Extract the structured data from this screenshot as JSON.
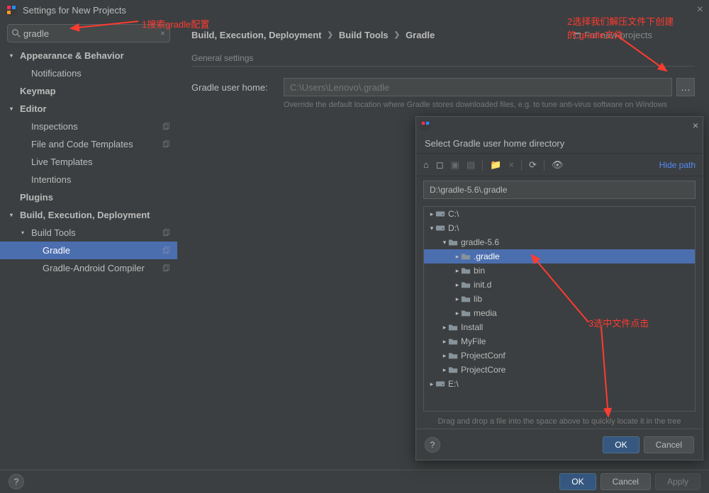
{
  "window": {
    "title": "Settings for New Projects"
  },
  "search": {
    "value": "gradle"
  },
  "sidebar": {
    "items": [
      {
        "label": "Appearance & Behavior",
        "bold": true,
        "arrow": "▾",
        "indent": 0
      },
      {
        "label": "Notifications",
        "bold": false,
        "arrow": "",
        "indent": 1
      },
      {
        "label": "Keymap",
        "bold": true,
        "arrow": "",
        "indent": 0
      },
      {
        "label": "Editor",
        "bold": true,
        "arrow": "▾",
        "indent": 0
      },
      {
        "label": "Inspections",
        "bold": false,
        "arrow": "",
        "indent": 1,
        "copy": true
      },
      {
        "label": "File and Code Templates",
        "bold": false,
        "arrow": "",
        "indent": 1,
        "copy": true
      },
      {
        "label": "Live Templates",
        "bold": false,
        "arrow": "",
        "indent": 1
      },
      {
        "label": "Intentions",
        "bold": false,
        "arrow": "",
        "indent": 1
      },
      {
        "label": "Plugins",
        "bold": true,
        "arrow": "",
        "indent": 0
      },
      {
        "label": "Build, Execution, Deployment",
        "bold": true,
        "arrow": "▾",
        "indent": 0
      },
      {
        "label": "Build Tools",
        "bold": false,
        "arrow": "▾",
        "indent": 1,
        "copy": true
      },
      {
        "label": "Gradle",
        "bold": false,
        "arrow": "",
        "indent": 2,
        "copy": true,
        "selected": true
      },
      {
        "label": "Gradle-Android Compiler",
        "bold": false,
        "arrow": "",
        "indent": 2,
        "copy": true
      }
    ]
  },
  "breadcrumb": {
    "a": "Build, Execution, Deployment",
    "b": "Build Tools",
    "c": "Gradle",
    "scope": "For new projects"
  },
  "general": {
    "section": "General settings",
    "label": "Gradle user home:",
    "placeholder": "C:\\Users\\Lenovo\\.gradle",
    "hint": "Override the default location where Gradle stores downloaded files, e.g. to tune anti-virus software on Windows"
  },
  "footer": {
    "ok": "OK",
    "cancel": "Cancel",
    "apply": "Apply"
  },
  "dialog": {
    "title": "Select Gradle user home directory",
    "hide_path": "Hide path",
    "path": "D:\\gradle-5.6\\.gradle",
    "hint": "Drag and drop a file into the space above to quickly locate it in the tree",
    "ok": "OK",
    "cancel": "Cancel",
    "tree": [
      {
        "label": "C:\\",
        "indent": 0,
        "arrow": "▸",
        "icon": "disk"
      },
      {
        "label": "D:\\",
        "indent": 0,
        "arrow": "▾",
        "icon": "disk"
      },
      {
        "label": "gradle-5.6",
        "indent": 1,
        "arrow": "▾",
        "icon": "folder"
      },
      {
        "label": ".gradle",
        "indent": 2,
        "arrow": "▸",
        "icon": "folder",
        "selected": true
      },
      {
        "label": "bin",
        "indent": 2,
        "arrow": "▸",
        "icon": "folder"
      },
      {
        "label": "init.d",
        "indent": 2,
        "arrow": "▸",
        "icon": "folder"
      },
      {
        "label": "lib",
        "indent": 2,
        "arrow": "▸",
        "icon": "folder"
      },
      {
        "label": "media",
        "indent": 2,
        "arrow": "▸",
        "icon": "folder"
      },
      {
        "label": "Install",
        "indent": 1,
        "arrow": "▸",
        "icon": "folder"
      },
      {
        "label": "MyFile",
        "indent": 1,
        "arrow": "▸",
        "icon": "folder"
      },
      {
        "label": "ProjectConf",
        "indent": 1,
        "arrow": "▸",
        "icon": "folder"
      },
      {
        "label": "ProjectCore",
        "indent": 1,
        "arrow": "▸",
        "icon": "folder"
      },
      {
        "label": "E:\\",
        "indent": 0,
        "arrow": "▸",
        "icon": "disk"
      }
    ]
  },
  "annotations": {
    "a1": "1搜索gradle配置",
    "a2": "2选择我们解压文件下创建的.gradle文件",
    "a3": "3选中文件点击"
  }
}
